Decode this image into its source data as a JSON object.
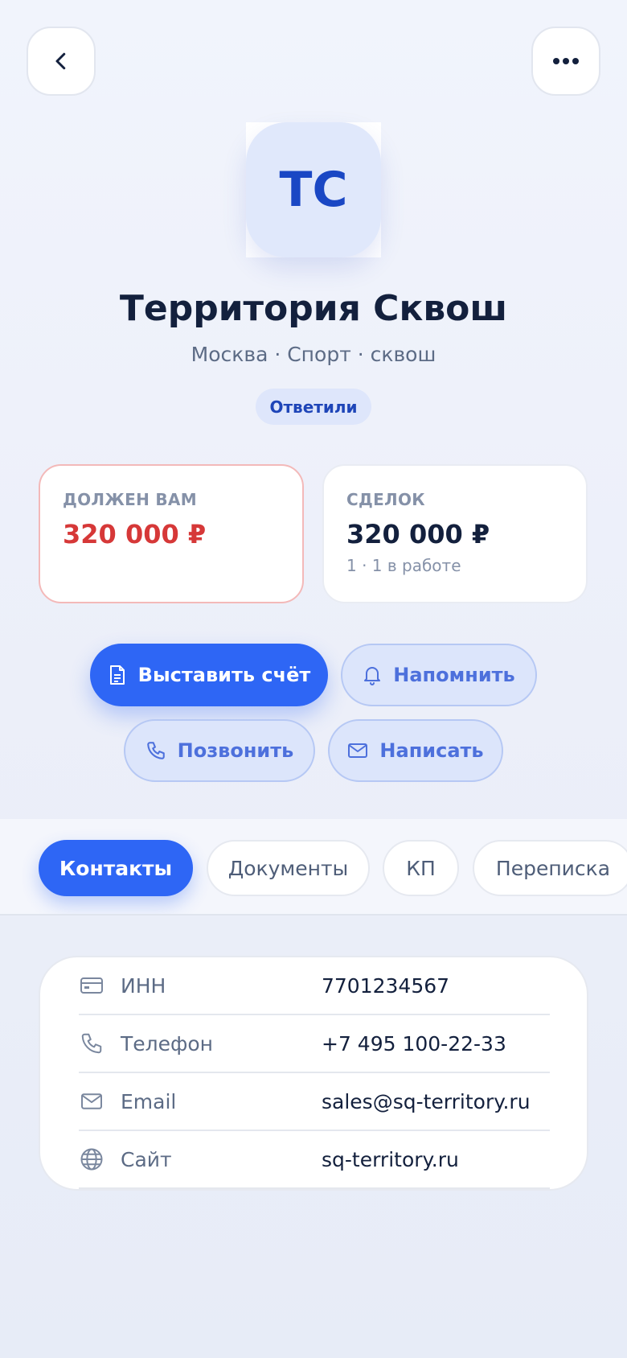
{
  "company": {
    "initials": "ТС",
    "name": "Территория Сквош",
    "subtitle": "Москва · Спорт · сквош",
    "status": "Ответили"
  },
  "stats": {
    "debt": {
      "label": "ДОЛЖЕН ВАМ",
      "value": "320 000 ₽"
    },
    "deals": {
      "label": "СДЕЛОК",
      "value": "320 000 ₽",
      "sub": "1 · 1 в работе"
    }
  },
  "actions": {
    "invoice": "Выставить счёт",
    "remind": "Напомнить",
    "call": "Позвонить",
    "write": "Написать"
  },
  "tabs": [
    {
      "label": "Контакты",
      "active": true
    },
    {
      "label": "Документы",
      "active": false
    },
    {
      "label": "КП",
      "active": false
    },
    {
      "label": "Переписка",
      "active": false
    }
  ],
  "contacts": [
    {
      "icon": "card-icon",
      "label": "ИНН",
      "value": "7701234567"
    },
    {
      "icon": "phone-icon",
      "label": "Телефон",
      "value": "+7 495 100-22-33"
    },
    {
      "icon": "mail-icon",
      "label": "Email",
      "value": "sales@sq-territory.ru"
    },
    {
      "icon": "globe-icon",
      "label": "Сайт",
      "value": "sq-territory.ru"
    }
  ],
  "colors": {
    "accent": "#2e66f5",
    "debt": "#d63838",
    "badge_bg": "#dee6fb"
  }
}
